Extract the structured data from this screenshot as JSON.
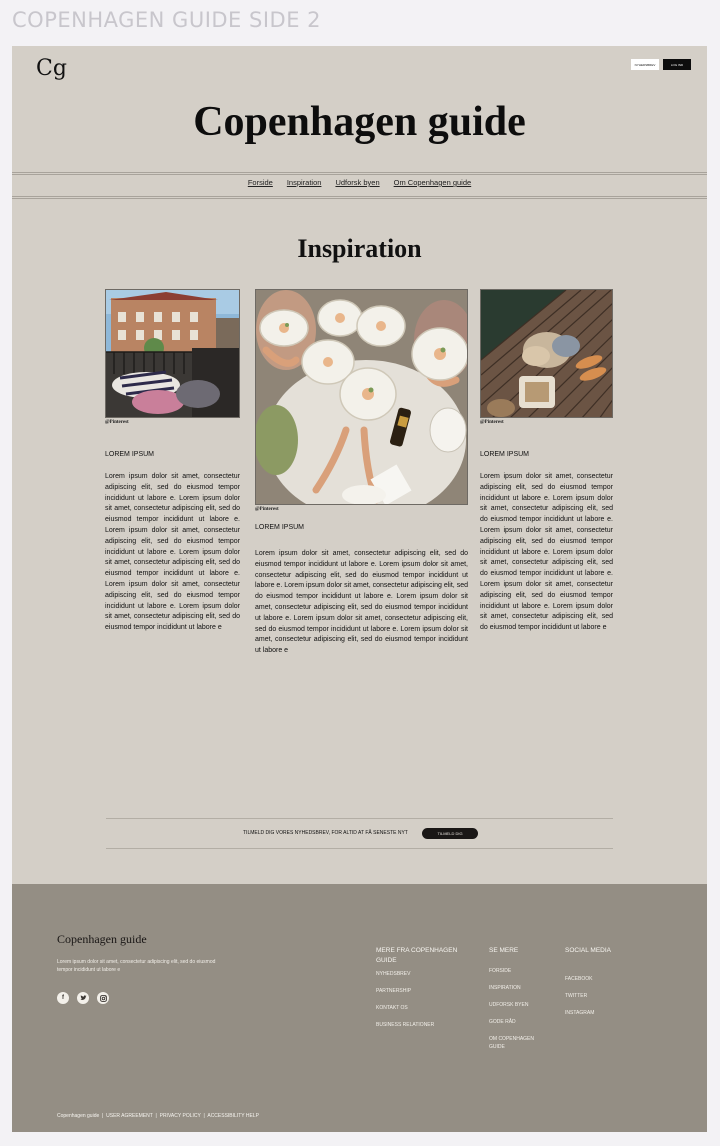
{
  "board_title": "COPENHAGEN GUIDE SIDE 2",
  "header": {
    "logo": "Cg",
    "button_light": "NYHEDSBREV",
    "button_dark": "LOG IND",
    "title": "Copenhagen guide"
  },
  "nav": [
    "Forside",
    "Inspiration",
    "Udforsk byen",
    "Om Copenhagen guide"
  ],
  "section_title": "Inspiration",
  "columns": [
    {
      "credit": "@Pinterest",
      "title": "LOREM IPSUM",
      "text": "Lorem ipsum dolor sit amet, consectetur adipiscing elit, sed do eiusmod tempor incididunt ut labore e. Lorem ipsum dolor sit amet, consectetur adipiscing elit, sed do eiusmod tempor incididunt ut labore e. Lorem ipsum dolor sit amet, consectetur adipiscing elit, sed do eiusmod tempor incididunt ut labore e. Lorem ipsum dolor sit amet, consectetur adipiscing elit, sed do eiusmod tempor incididunt ut labore e. Lorem ipsum dolor sit amet, consectetur adipiscing elit, sed do eiusmod tempor incididunt ut labore e. Lorem ipsum dolor sit amet, consectetur adipiscing elit, sed do eiusmod tempor incididunt ut labore e"
    },
    {
      "credit": "@Pinterest",
      "title": "LOREM IPSUM",
      "text": "Lorem ipsum dolor sit amet, consectetur adipiscing elit, sed do eiusmod tempor incididunt ut labore e. Lorem ipsum dolor sit amet, consectetur adipiscing elit, sed do eiusmod tempor incididunt ut labore e. Lorem ipsum dolor sit amet, consectetur adipiscing elit, sed do eiusmod tempor incididunt ut labore e. Lorem ipsum dolor sit amet, consectetur adipiscing elit, sed do eiusmod tempor incididunt ut labore e. Lorem ipsum dolor sit amet, consectetur adipiscing elit, sed do eiusmod tempor incididunt ut labore e. Lorem ipsum dolor sit amet, consectetur adipiscing elit, sed do eiusmod tempor incididunt ut labore e"
    },
    {
      "credit": "@Pinterest",
      "title": "LOREM IPSUM",
      "text": "Lorem ipsum dolor sit amet, consectetur adipiscing elit, sed do eiusmod tempor incididunt ut labore e. Lorem ipsum dolor sit amet, consectetur adipiscing elit, sed do eiusmod tempor incididunt ut labore e. Lorem ipsum dolor sit amet, consectetur adipiscing elit, sed do eiusmod tempor incididunt ut labore e. Lorem ipsum dolor sit amet, consectetur adipiscing elit, sed do eiusmod tempor incididunt ut labore e. Lorem ipsum dolor sit amet, consectetur adipiscing elit, sed do eiusmod tempor incididunt ut labore e. Lorem ipsum dolor sit amet, consectetur adipiscing elit, sed do eiusmod tempor incididunt ut labore e"
    }
  ],
  "newsletter": {
    "text": "TILMELD DIG VORES NYHEDSBREV, FOR ALTID AT FÅ SENESTE NYT",
    "button": "TILMELD DIG"
  },
  "footer": {
    "logo": "Copenhagen guide",
    "description": "Lorem ipsum dolor sit amet, consectetur adipiscing elit, sed do eiusmod tempor incididunt ut labore e",
    "social_icons": [
      "facebook-icon",
      "twitter-icon",
      "instagram-icon"
    ],
    "col1": {
      "heading": "MERE FRA COPENHAGEN GUIDE",
      "links": [
        "NYHEDSBREV",
        "PARTNERSHIP",
        "KONTAKT OS",
        "BUSINESS RELATIONER"
      ]
    },
    "col2": {
      "heading": "SE MERE",
      "links": [
        "FORSIDE",
        "INSPIRATION",
        "UDFORSK BYEN",
        "GODE RÅD",
        "OM COPENHAGEN GUIDE"
      ]
    },
    "col3": {
      "heading": "SOCIAL MEDIA",
      "links": [
        "FACEBOOK",
        "TWITTER",
        "INSTAGRAM"
      ]
    },
    "bottom": [
      "Copenhagen guide",
      "USER AGREEMENT",
      "PRIVACY POLICY",
      "ACCESSIBILITY HELP"
    ],
    "separator": "|"
  }
}
